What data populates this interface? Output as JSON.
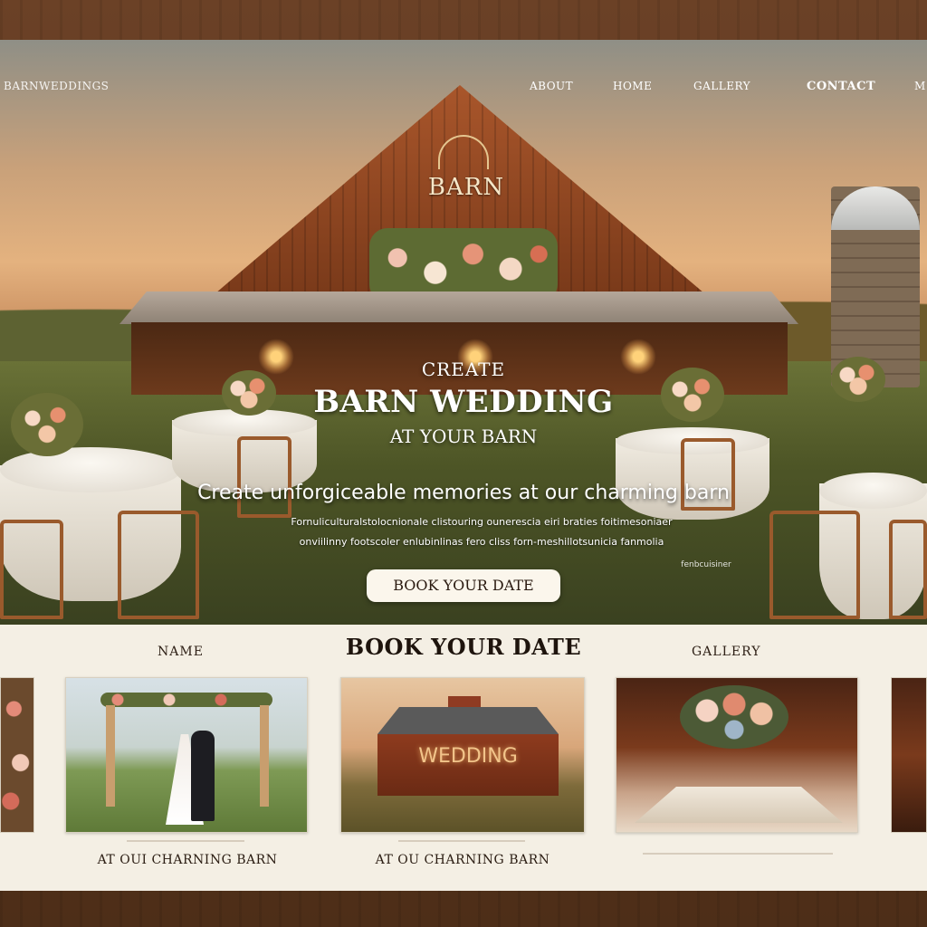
{
  "nav": {
    "brand": "BARNWEDDINGS",
    "links": [
      "ABOUT",
      "HOME",
      "GALLERY",
      "CONTACT",
      "M"
    ]
  },
  "hero": {
    "barn_sign": "BARN",
    "eyebrow": "CREATE",
    "title": "BARN WEDDING",
    "subtitle": "AT YOUR BARN",
    "tagline": "Create unforgiceable memories at our charming barn",
    "body_lines": [
      "Fornuliculturalstolocnionale clistouring ounerescia eiri braties foitimesoniaer",
      "onviilinny footscoler enlubinlinas fero cliss forn-meshillotsunicia fanmolia"
    ],
    "note": "fenbcuisiner",
    "cta_label": "BOOK YOUR DATE"
  },
  "section": {
    "left_label": "NAME",
    "title": "BOOK YOUR DATE",
    "right_label": "GALLERY"
  },
  "cards": [
    {
      "caption": "AT OUI CHARNING BARN"
    },
    {
      "caption": "AT OU CHARNING BARN",
      "image_text": "WEDDING"
    },
    {
      "caption": ""
    }
  ],
  "colors": {
    "cta_bg": "#fbf6ec",
    "section_bg": "#f4efe4",
    "barn_red": "#8e3b1e"
  }
}
